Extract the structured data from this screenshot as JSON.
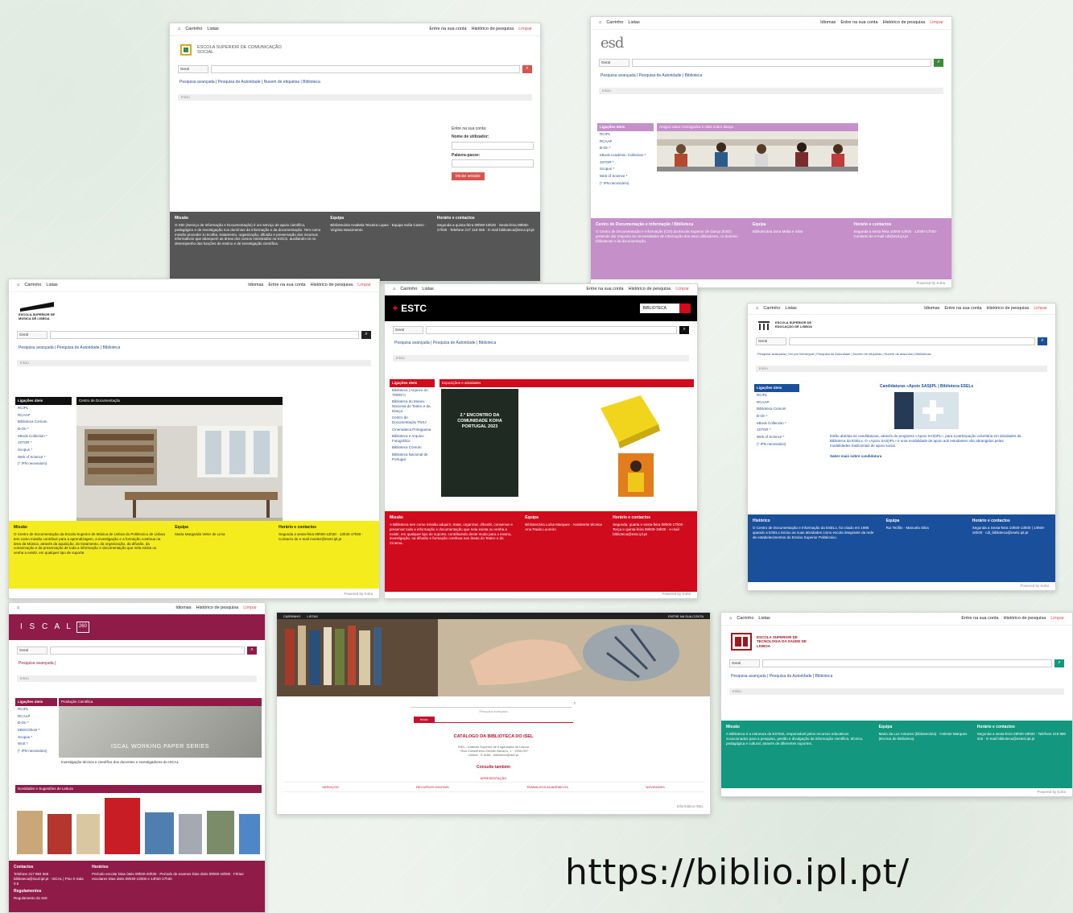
{
  "url": "https://biblio.ipl.pt/",
  "common": {
    "cart": "Carrinho",
    "lists": "Listas",
    "languages": "Idiomas",
    "login": "Entre na sua conta",
    "history": "Histórico de pesquisa",
    "clear": "Limpar",
    "search_type": "Geral",
    "breadcrumb_home": "Início",
    "powered_by": "Powered by Koha",
    "useful_links": "Ligações úteis",
    "mission": "Missão",
    "team": "Equipa",
    "hours_contacts": "Horário e contactos"
  },
  "escs": {
    "logo_text": "ESCOLA SUPERIOR DE COMUNICAÇÃO SOCIAL",
    "links": "Pesquisa avançada | Pesquisa de Autoridade | Nuvem de etiquetas | Biblioteca",
    "login_title": "Entre na sua conta:",
    "user_label": "Nome de utilizador:",
    "pass_label": "Palavra-passe:",
    "login_button": "Iniciar sessão",
    "mission_text": "O SID (Serviço de Informação e Documentação) é um serviço de apoio científico, pedagógico e de investigação nos domínios da informação e da documentação. Tem como missão proceder à recolha, tratamento, organização, difusão e preservação dos recursos informativos que abarquem as áreas dos cursos ministrados na ESCS, auxiliando-os no desempenho das funções de ensino e de investigação científica.",
    "team_text": "Bibliotecária Anabela Teixeira Lopes · Equipa Sofia Castro · Virgínia Nascimento",
    "hours_text": "Segunda a quinta-feira 09h00-19h30 · Sexta-feira 09h00-17h00 · Telefone 217 119 065 · E-mail biblioteca@escs.ipl.pt"
  },
  "esd": {
    "logo_text": "esd",
    "links": "Pesquisa avançada | Pesquisa de Autoridade | Biblioteca",
    "sidebar": [
      "RCIPL",
      "RCAAP",
      "B-On *",
      "eBook Academic Collection *",
      "JSTOR *",
      "Scopus *",
      "Web of Science *",
      "(* IPN necessário)"
    ],
    "panel_title": "Artigos sobre coreógrafos e sites sobre dança",
    "footer_title": "Centro de Documentação e Informação / Biblioteca",
    "footer_text": "O Centro de Documentação e Informação (CDI) da Escola Superior de Dança (ESD) pretende dar resposta às necessidades de informação dos seus utilizadores, no domínio bibliotecas e da documentação.",
    "team_text": "Bibliotecária Dora Malta e Silva",
    "hours_text": "Segunda a sexta-feira 10h00-13h00 · 14h00-17h00 · Contacto de e-mail cdi@esd.ipl.pt"
  },
  "esml": {
    "logo_text": "ESCOLA SUPERIOR DE MÚSICA DE LISBOA",
    "links": "Pesquisa avançada | Pesquisa de Autoridade | Biblioteca",
    "sidebar": [
      "RCIPL",
      "RCAAP",
      "Biblioteca Comum",
      "B-On *",
      "eBook Collection *",
      "JSTOR *",
      "Scopus *",
      "Web of Science *",
      "(* IPN necessário)"
    ],
    "panel_title": "Centro de Documentação",
    "mission_text": "O Centro de Documentação da Escola Superior de Música de Lisboa do Politécnico de Lisboa tem como missão contribuir para a aprendizagem, a investigação e a formação contínua na área da Música, através da aquisição, do tratamento, da organização, da difusão, da conservação e da preservação de toda a informação e documentação que nela exista ou venha a existir, em qualquer tipo de suporte.",
    "team_text": "Maria Margarida Velez de Lima",
    "hours_text": "Segunda a sexta-feira 09h00-12h30 · 13h30-17h00 · Contacto de e-mail mvelez@esml.ipl.pt"
  },
  "estc": {
    "logo_text": "ESTC",
    "badge": "BIBLIOTECA",
    "links": "Pesquisa avançada | Pesquisa de Autoridade | Biblioteca",
    "sidebar": [
      "Biblioteca | Arquivo do TNDM II",
      "Biblioteca do Museu Nacional do Teatro e da Dança",
      "Centro de Documentação TNSJ",
      "Cinemateca Portuguesa",
      "Biblioteca e Arquivo Fotográfico",
      "Biblioteca Comum",
      "Biblioteca Nacional de Portugal"
    ],
    "panel_title": "Exposições e atividades",
    "poster_text": "2.º ENCONTRO DA COMUNIDADE KOHA PORTUGAL 2023",
    "mission_text": "A Biblioteca tem como missão adquirir, tratar, organizar, difundir, conservar e preservar toda a informação e documentação que nela exista ou venha a existir, em qualquer tipo de suporte, contribuindo deste modo para o ensino, investigação, na difusão e formação contínua nas áreas do Teatro e do Cinema.",
    "team_text": "Bibliotecária Luísa Marques · Assistente técnica Ana Paula Loureiro",
    "hours_text": "Segunda, quarta e sexta-feira 09h00-17h00 · Terça e quinta-feira 09h00-19h00 · e-mail biblioteca@estc.ipl.pt"
  },
  "eselx": {
    "logo_text": "ESCOLA SUPERIOR DE EDUCAÇÃO DE LISBOA",
    "links": "Pesquisa avançada | Ver por hierarquia | Pesquisa de Autoridade | Nuvem de etiquetas | Nuvem de assuntos | Bibliotecas",
    "sidebar": [
      "RCIPL",
      "RCAAP",
      "Biblioteca Comum",
      "B-On *",
      "eBook Collection *",
      "JSTOR *",
      "Web of Science *",
      "(* IPN necessário)"
    ],
    "news_title": "Candidaturas «Apoio SAS|IPL | Biblioteca ESELx",
    "news_text": "Estão abertas as candidaturas, através do programa «Apoio SAS|IPL», para a participação voluntária em atividades da Biblioteca da ESELx. O «Apoio SAS|IPL» é uma modalidade de apoio aos estudantes não abrangidos pelas modalidades tradicionais de apoio social.",
    "more_link": "Saber mais sobre candidatura",
    "footer_title": "Histórico",
    "footer_text": "O Centro de Documentação e Informação da ESELx, foi criado em 1985 quando a ESELx iniciou as suas atividades como escola integrante da rede de estabelecimentos do Ensino Superior Politécnico.",
    "team_text": "Rui Teófilo · Manuela Silva",
    "hours_text": "Segunda a Sexta-feira 10h00-13h00 | 14h00-16h00 · cdi_biblioteca@eselx.ipl.pt"
  },
  "iscal": {
    "logo_text": "I S C A L",
    "logo_badge": "260",
    "links": "Pesquisa avançada |",
    "sidebar": [
      "RCIPL",
      "RCAAP",
      "B-On *",
      "EBSCOhost *",
      "Scopus *",
      "WoS *",
      "(* IPN necessário)"
    ],
    "panel_title": "Produção Científica",
    "banner_text": "ISCAL WORKING PAPER SERIES",
    "banner_caption": "Investigação técnica e científica dos docentes e investigadores do ISCAL",
    "novelties": "Novidades e Sugestões de Leitura",
    "contacts_title": "Contactos",
    "contacts_text": "Telefone 217 984 565 · biblioteca@iscal.ipl.pt · ISCAL | Piso 0 Sala 0.5",
    "rules_title": "Regulamentos",
    "rules_text": "Regulamento do SID",
    "hours_title": "Horários",
    "hours_text": "Período escolar Dias úteis 09h00-20h30 · Período de exames Dias úteis 09h00-18h00 · Férias escolares Dias úteis 09h30-13h00 e 14h00-17h30"
  },
  "isel": {
    "top_links": [
      "CARRINHO",
      "LISTAS"
    ],
    "top_right": "ENTRE NA SUA CONTA",
    "search_label": "Pesquisa avançada",
    "tab": "Início",
    "catalog_title": "CATÁLOGO DA BIBLIOTECA DO ISEL",
    "address": "ISEL - Instituto Superior de Engenharia de Lisboa · Rua Conselheiro Emídio Navarro, 1 · 1959-007 Lisboa · E-MAIL: biblioteca@isel.pt",
    "also": "Consulte também",
    "presentation": "APRESENTAÇÃO",
    "footer_items": [
      "SERVIÇOS",
      "RECURSOS DIGITAIS",
      "TRABALHOS ACADÉMICOS",
      "NOVIDADES"
    ],
    "credit": "Informática ISEL"
  },
  "estesl": {
    "logo_text": "ESCOLA SUPERIOR DE TECNOLOGIA DA SAÚDE DE LISBOA",
    "links": "Pesquisa avançada | Pesquisa de Autoridade | Biblioteca",
    "mission_text": "A Biblioteca é a estrutura da ESTeSL responsável pelos recursos educativos vocacionados para a pesquisa, gestão e divulgação da informação científica, técnica, pedagógica e cultural, através de diferentes suportes.",
    "team_text": "Maria da Luz Antunes (bibliotecária) · Celeste Marques (técnica de biblioteca)",
    "hours_text": "Segunda a sexta-feira 09h00-18h00 · Telefone 218 980 416 · E-mail biblioteca@estesl.ipl.pt"
  },
  "colors": {
    "escs_footer": "#565656",
    "esd_footer": "#c58fc9",
    "esml_footer": "#f4ec1c",
    "estc_red": "#d10b1e",
    "eselx_blue": "#1a4f9c",
    "iscal_wine": "#8f1c48",
    "estesl_teal": "#13977e"
  }
}
